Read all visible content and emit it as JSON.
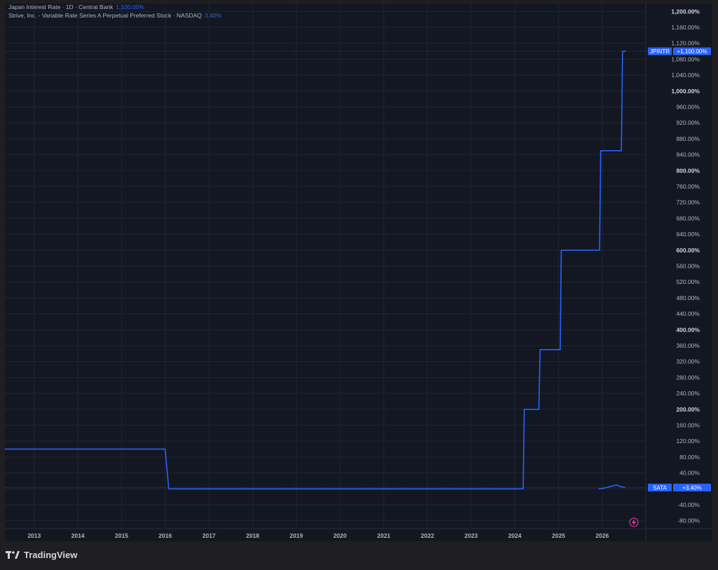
{
  "legend": [
    {
      "label": "Japan Interest Rate · 1D · Central Bank",
      "value": "1,100.00%"
    },
    {
      "label": "Strive, Inc. - Variable Rate Series A Perpetual Preferred Stock · NASDAQ",
      "value": "3.40%"
    }
  ],
  "branding": {
    "name": "TradingView"
  },
  "colors": {
    "background": "#131722",
    "page": "#1f1f21",
    "line": "#2962ff",
    "grid": "#1e2536",
    "text": "#b2b5be"
  },
  "chart_data": {
    "type": "line",
    "title": "",
    "xlabel": "",
    "ylabel": "",
    "x_range": [
      "2012-05-01",
      "2026-12-31"
    ],
    "ylim": [
      -100,
      1220
    ],
    "y_ticks": [
      "1,200.00%",
      "1,160.00%",
      "1,120.00%",
      "1,080.00%",
      "1,040.00%",
      "1,000.00%",
      "960.00%",
      "920.00%",
      "880.00%",
      "840.00%",
      "800.00%",
      "760.00%",
      "720.00%",
      "680.00%",
      "640.00%",
      "600.00%",
      "560.00%",
      "520.00%",
      "480.00%",
      "440.00%",
      "400.00%",
      "360.00%",
      "320.00%",
      "280.00%",
      "240.00%",
      "200.00%",
      "160.00%",
      "120.00%",
      "80.00%",
      "40.00%",
      "0.00%",
      "-40.00%",
      "-80.00%"
    ],
    "y_tick_values": [
      1200,
      1160,
      1120,
      1080,
      1040,
      1000,
      960,
      920,
      880,
      840,
      800,
      760,
      720,
      680,
      640,
      600,
      560,
      520,
      480,
      440,
      400,
      360,
      320,
      280,
      240,
      200,
      160,
      120,
      80,
      40,
      0,
      -40,
      -80
    ],
    "x_ticks": [
      "2013",
      "2014",
      "2015",
      "2016",
      "2017",
      "2018",
      "2019",
      "2020",
      "2021",
      "2022",
      "2023",
      "2024",
      "2025",
      "2026"
    ],
    "x_tick_dates": [
      "2013-01-01",
      "2014-01-01",
      "2015-01-01",
      "2016-01-01",
      "2017-01-01",
      "2018-01-01",
      "2019-01-01",
      "2020-01-01",
      "2021-01-01",
      "2022-01-01",
      "2023-01-01",
      "2024-01-01",
      "2025-01-01",
      "2026-01-01"
    ],
    "grid": true,
    "series": [
      {
        "name": "JPINTR",
        "badge": "+1,100.00%",
        "last_value": 1100,
        "points": [
          [
            "2012-05-01",
            100
          ],
          [
            "2015-12-31",
            100
          ],
          [
            "2016-01-31",
            0
          ],
          [
            "2024-03-11",
            0
          ],
          [
            "2024-03-20",
            200
          ],
          [
            "2024-07-20",
            200
          ],
          [
            "2024-07-31",
            350
          ],
          [
            "2025-01-15",
            350
          ],
          [
            "2025-01-24",
            600
          ],
          [
            "2025-12-10",
            600
          ],
          [
            "2025-12-19",
            850
          ],
          [
            "2026-06-10",
            850
          ],
          [
            "2026-06-20",
            1100
          ],
          [
            "2026-07-20",
            1100
          ]
        ]
      },
      {
        "name": "SATA",
        "badge": "+3.40%",
        "last_value": 3.4,
        "points": [
          [
            "2025-12-01",
            0
          ],
          [
            "2026-01-01",
            1
          ],
          [
            "2026-02-01",
            3
          ],
          [
            "2026-03-01",
            5
          ],
          [
            "2026-04-01",
            8
          ],
          [
            "2026-05-01",
            10
          ],
          [
            "2026-06-01",
            6
          ],
          [
            "2026-07-10",
            3.4
          ]
        ]
      }
    ]
  }
}
